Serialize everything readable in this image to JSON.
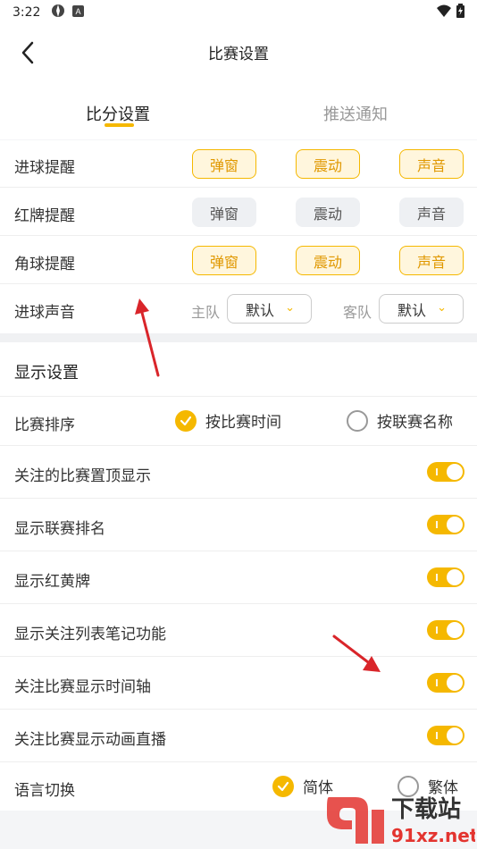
{
  "status": {
    "time": "3:22"
  },
  "header": {
    "title": "比赛设置"
  },
  "tabs": [
    {
      "label": "比分设置"
    },
    {
      "label": "推送通知"
    }
  ],
  "score_settings": {
    "rows": [
      {
        "label": "进球提醒",
        "options": [
          "弹窗",
          "震动",
          "声音"
        ],
        "states": [
          true,
          true,
          true
        ]
      },
      {
        "label": "红牌提醒",
        "options": [
          "弹窗",
          "震动",
          "声音"
        ],
        "states": [
          false,
          false,
          false
        ]
      },
      {
        "label": "角球提醒",
        "options": [
          "弹窗",
          "震动",
          "声音"
        ],
        "states": [
          true,
          true,
          true
        ]
      }
    ],
    "sound": {
      "label": "进球声音",
      "home_label": "主队",
      "home_value": "默认",
      "away_label": "客队",
      "away_value": "默认"
    }
  },
  "display": {
    "title": "显示设置",
    "sort": {
      "label": "比赛排序",
      "option1": "按比赛时间",
      "option2": "按联赛名称",
      "selected": 1
    },
    "toggles": [
      {
        "label": "关注的比赛置顶显示",
        "on": true
      },
      {
        "label": "显示联赛排名",
        "on": true
      },
      {
        "label": "显示红黄牌",
        "on": true
      },
      {
        "label": "显示关注列表笔记功能",
        "on": true
      },
      {
        "label": "关注比赛显示时间轴",
        "on": true
      },
      {
        "label": "关注比赛显示动画直播",
        "on": true
      }
    ],
    "language": {
      "label": "语言切换",
      "option1": "简体",
      "option2": "繁体",
      "selected": 1
    }
  },
  "watermark": {
    "text1": "下载站",
    "text2": "91xz.net"
  },
  "colors": {
    "accent": "#f5b800",
    "arrow": "#d9252a"
  }
}
